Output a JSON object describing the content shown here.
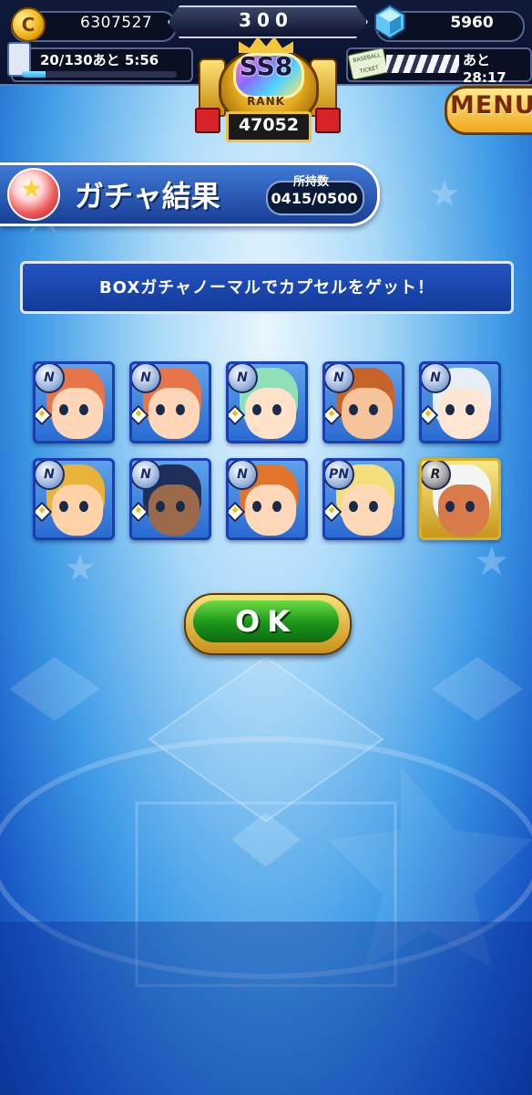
{
  "topbar": {
    "coins": "6307527",
    "center_value": "300",
    "gems": "5960",
    "stamina": "20/130あと 5:56",
    "stamina_fraction": 0.154,
    "ticket_icon_text": "BASEBALL TICKET",
    "ticket_timer": "あと28:17"
  },
  "rank": {
    "code": "SS8",
    "word": "RANK",
    "points": "47052"
  },
  "menu": {
    "label": "MENU"
  },
  "header": {
    "title": "ガチャ結果",
    "count_label": "所持数",
    "count_value": "0415/0500"
  },
  "message": "BOXガチャノーマルでカプセルをゲット！",
  "cards": [
    {
      "rarity": "N",
      "hair": "#e8744a",
      "skin": "#ffd6b8"
    },
    {
      "rarity": "N",
      "hair": "#e8744a",
      "skin": "#ffd6b8"
    },
    {
      "rarity": "N",
      "hair": "#8fe0b8",
      "skin": "#ffe2c8"
    },
    {
      "rarity": "N",
      "hair": "#c8642a",
      "skin": "#f6c49a"
    },
    {
      "rarity": "N",
      "hair": "#e8eef6",
      "skin": "#ffe6d2"
    },
    {
      "rarity": "N",
      "hair": "#e9b23a",
      "skin": "#ffd2a8"
    },
    {
      "rarity": "N",
      "hair": "#1f2f5a",
      "skin": "#9a6a4a"
    },
    {
      "rarity": "N",
      "hair": "#e0742a",
      "skin": "#ffd8ba"
    },
    {
      "rarity": "PN",
      "hair": "#f4e07a",
      "skin": "#ffd8b8"
    },
    {
      "rarity": "R",
      "hair": "#f4f4f4",
      "skin": "#d87a4a"
    }
  ],
  "ok_button": {
    "label": "OK"
  },
  "colors": {
    "accent_blue": "#1a3fb0",
    "ok_green": "#1e9a1c",
    "gold": "#f0b418"
  }
}
